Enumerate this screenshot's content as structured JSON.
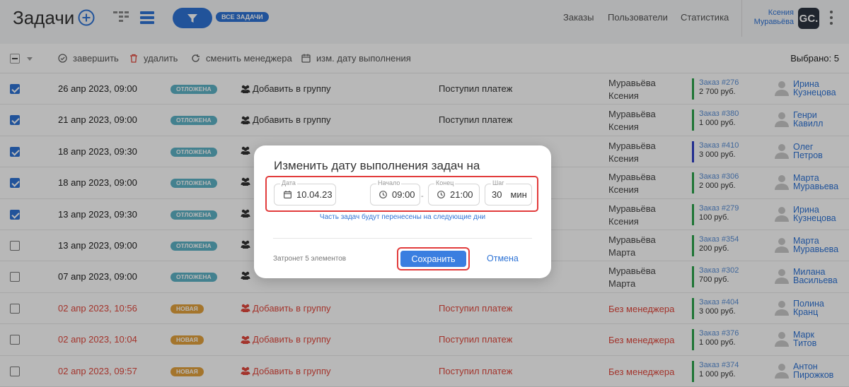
{
  "header": {
    "title": "Задачи",
    "filter_badge": "ВСЕ ЗАДАЧИ",
    "nav": [
      "Заказы",
      "Пользователи",
      "Статистика"
    ],
    "user_first": "Ксения",
    "user_last": "Муравьёва",
    "avatar": "GC."
  },
  "toolbar": {
    "complete": "завершить",
    "delete": "удалить",
    "change_manager": "сменить менеджера",
    "change_date": "изм. дату выполнения",
    "selected": "Выбрано: 5"
  },
  "rows": [
    {
      "checked": true,
      "date": "26 апр 2023, 09:00",
      "status": "ОТЛОЖЕНА",
      "action": "Добавить в группу",
      "reason": "Поступил платеж",
      "manager1": "Муравьёва",
      "manager2": "Ксения",
      "order_num": "Заказ #276",
      "order_sum": "2 700 руб.",
      "client1": "Ирина",
      "client2": "Кузнецова"
    },
    {
      "checked": true,
      "date": "21 апр 2023, 09:00",
      "status": "ОТЛОЖЕНА",
      "action": "Добавить в группу",
      "reason": "Поступил платеж",
      "manager1": "Муравьёва",
      "manager2": "Ксения",
      "order_num": "Заказ #380",
      "order_sum": "1 000 руб.",
      "client1": "Генри",
      "client2": "Кавилл"
    },
    {
      "checked": true,
      "date": "18 апр 2023, 09:30",
      "status": "ОТЛОЖЕНА",
      "action": "",
      "reason": "",
      "manager1": "Муравьёва",
      "manager2": "Ксения",
      "order_num": "Заказ #410",
      "order_sum": "3 000 руб.",
      "client1": "Олег",
      "client2": "Петров",
      "blue": true
    },
    {
      "checked": true,
      "date": "18 апр 2023, 09:00",
      "status": "ОТЛОЖЕНА",
      "action": "",
      "reason": "",
      "manager1": "Муравьёва",
      "manager2": "Ксения",
      "order_num": "Заказ #306",
      "order_sum": "2 000 руб.",
      "client1": "Марта",
      "client2": "Муравьева"
    },
    {
      "checked": true,
      "date": "13 апр 2023, 09:30",
      "status": "ОТЛОЖЕНА",
      "action": "",
      "reason": "",
      "manager1": "Муравьёва",
      "manager2": "Ксения",
      "order_num": "Заказ #279",
      "order_sum": "100 руб.",
      "client1": "Ирина",
      "client2": "Кузнецова"
    },
    {
      "checked": false,
      "date": "13 апр 2023, 09:00",
      "status": "ОТЛОЖЕНА",
      "action": "",
      "reason": "",
      "manager1": "Муравьёва",
      "manager2": "Марта",
      "order_num": "Заказ #354",
      "order_sum": "200 руб.",
      "client1": "Марта",
      "client2": "Муравьева"
    },
    {
      "checked": false,
      "date": "07 апр 2023, 09:00",
      "status": "ОТЛОЖЕНА",
      "action": "",
      "reason": "",
      "manager1": "Муравьёва",
      "manager2": "Марта",
      "order_num": "Заказ #302",
      "order_sum": "700 руб.",
      "client1": "Милана",
      "client2": "Васильева"
    },
    {
      "checked": false,
      "date": "02 апр 2023, 10:56",
      "status": "НОВАЯ",
      "action": "Добавить в группу",
      "reason": "Поступил платеж",
      "manager1": "Без менеджера",
      "manager2": "",
      "order_num": "Заказ #404",
      "order_sum": "3 000 руб.",
      "client1": "Полина",
      "client2": "Кранц",
      "red": true
    },
    {
      "checked": false,
      "date": "02 апр 2023, 10:04",
      "status": "НОВАЯ",
      "action": "Добавить в группу",
      "reason": "Поступил платеж",
      "manager1": "Без менеджера",
      "manager2": "",
      "order_num": "Заказ #376",
      "order_sum": "1 000 руб.",
      "client1": "Марк",
      "client2": "Титов",
      "red": true
    },
    {
      "checked": false,
      "date": "02 апр 2023, 09:57",
      "status": "НОВАЯ",
      "action": "Добавить в группу",
      "reason": "Поступил платеж",
      "manager1": "Без менеджера",
      "manager2": "",
      "order_num": "Заказ #374",
      "order_sum": "1 000 руб.",
      "client1": "Антон",
      "client2": "Пирожков",
      "red": true
    }
  ],
  "modal": {
    "title": "Изменить дату выполнения задач на",
    "date_label": "Дата",
    "date_value": "10.04.23",
    "start_label": "Начало",
    "start_value": "09:00",
    "dash": "-",
    "end_label": "Конец",
    "end_value": "21:00",
    "step_label": "Шаг",
    "step_value": "30",
    "step_unit": "мин",
    "hint": "Часть задач будут перенесены на следующие дни",
    "affects": "Затронет 5 элементов",
    "save": "Сохранить",
    "cancel": "Отмена"
  }
}
